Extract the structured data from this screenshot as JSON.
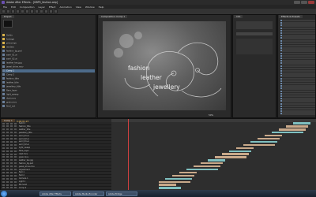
{
  "window": {
    "title": "Adobe After Effects - [GBP5_fashion.aep]"
  },
  "menu": [
    "File",
    "Edit",
    "Composition",
    "Layer",
    "Effect",
    "Animation",
    "View",
    "Window",
    "Help"
  ],
  "project": {
    "tab": "Project",
    "items": [
      {
        "label": "Solids",
        "type": "folder"
      },
      {
        "label": "footage",
        "type": "folder"
      },
      {
        "label": "precomps",
        "type": "folder"
      },
      {
        "label": "renders",
        "type": "folder"
      },
      {
        "label": "fashion_bg.psd",
        "type": "file"
      },
      {
        "label": "swirl_01.ai",
        "type": "file"
      },
      {
        "label": "swirl_02.ai",
        "type": "file"
      },
      {
        "label": "leather_tex.jpg",
        "type": "file"
      },
      {
        "label": "jewel_shine.mov",
        "type": "file"
      },
      {
        "label": "Comp 1",
        "type": "file",
        "selected": true
      },
      {
        "label": "Comp 2",
        "type": "file"
      },
      {
        "label": "fashion_title",
        "type": "file"
      },
      {
        "label": "leather_title",
        "type": "file"
      },
      {
        "label": "jewellery_title",
        "type": "file"
      },
      {
        "label": "flare_layer",
        "type": "file"
      },
      {
        "label": "light_sweep",
        "type": "file"
      },
      {
        "label": "dust.mov",
        "type": "file"
      },
      {
        "label": "grain.mov",
        "type": "file"
      },
      {
        "label": "final_out",
        "type": "file"
      }
    ]
  },
  "viewer": {
    "tab": "Composition: Comp 1",
    "text_lines": [
      "fashion",
      "leather",
      "jewellery"
    ],
    "zoom": "50%"
  },
  "right_panel": {
    "tab": "Info",
    "list_tab": "Effects & Presets"
  },
  "timeline": {
    "tab": "Comp 1",
    "timecode": "0;00;01;23",
    "layers": [
      "Solid 1",
      "fashion_title",
      "leather_title",
      "jewellery_title",
      "swirl_01.ai",
      "swirl_02.ai",
      "swirl_01.ai",
      "swirl_02.ai",
      "light_sweep",
      "flare_layer",
      "dust.mov",
      "grain.mov",
      "leather_tex.jpg",
      "fashion_bg.psd",
      "jewel_shine.mov",
      "Adjustment",
      "Null 1",
      "Null 2",
      "Camera 1",
      "Light 1",
      "BG Solid",
      "Comp 2"
    ]
  },
  "taskbar": {
    "buttons": [
      "Adobe After Effects",
      "Adobe Media Encoder",
      "Adobe Bridge"
    ]
  },
  "colors": {
    "accent": "#6c88a8",
    "selection": "#4d6b8a",
    "playhead": "#d04040",
    "bar_tan": "#c9a98a",
    "bar_teal": "#7fc0c0"
  }
}
